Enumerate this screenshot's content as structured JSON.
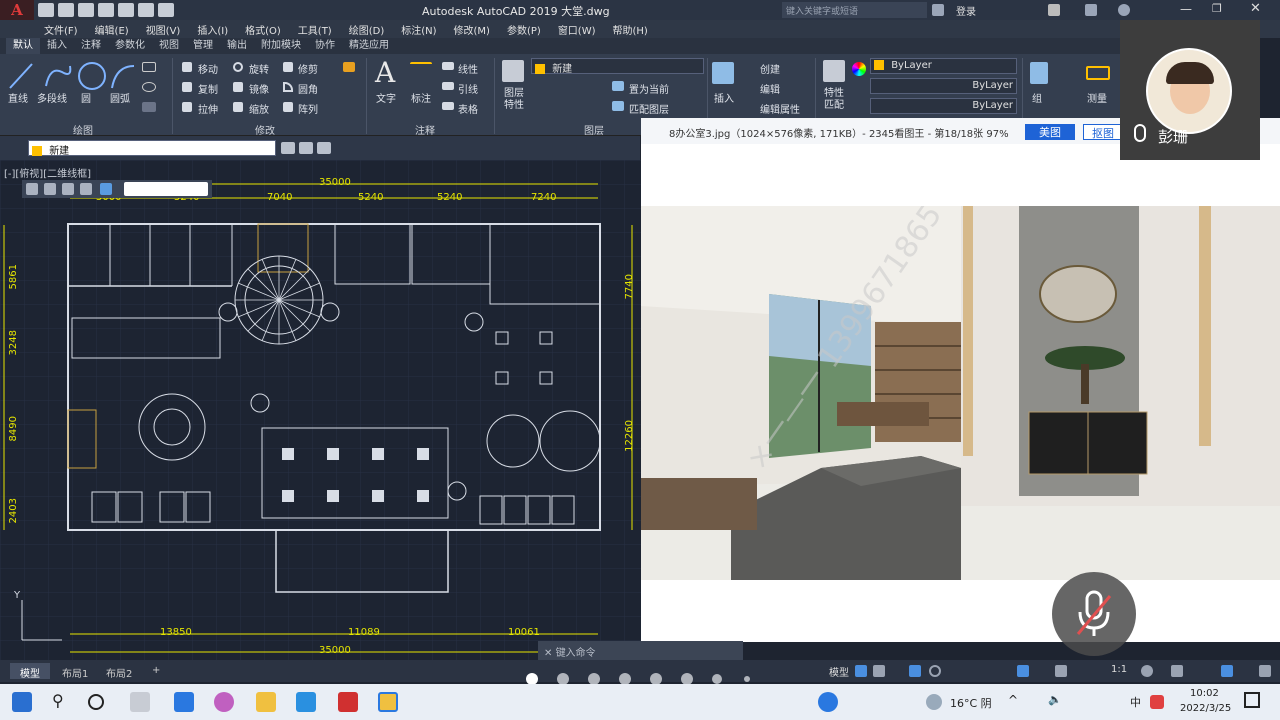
{
  "app": {
    "title": "Autodesk AutoCAD 2019    大堂.dwg",
    "search_placeholder": "键入关键字或短语",
    "login": "登录",
    "logo": "A"
  },
  "menu": [
    "文件(F)",
    "编辑(E)",
    "视图(V)",
    "插入(I)",
    "格式(O)",
    "工具(T)",
    "绘图(D)",
    "标注(N)",
    "修改(M)",
    "参数(P)",
    "窗口(W)",
    "帮助(H)"
  ],
  "ribbon_tabs": [
    "默认",
    "插入",
    "注释",
    "参数化",
    "视图",
    "管理",
    "输出",
    "附加模块",
    "协作",
    "精选应用"
  ],
  "ribbon": {
    "draw": {
      "line": "直线",
      "polyline": "多段线",
      "circle": "圆",
      "arc": "圆弧",
      "panel": "绘图"
    },
    "modify": {
      "move": "移动",
      "rotate": "旋转",
      "trim": "修剪",
      "copy": "复制",
      "mirror": "镜像",
      "fillet": "圆角",
      "stretch": "拉伸",
      "scale": "缩放",
      "array": "阵列",
      "panel": "修改"
    },
    "annotation": {
      "text": "文字",
      "dimension": "标注",
      "linear": "线性",
      "leader": "引线",
      "table": "表格",
      "panel": "注释"
    },
    "layers": {
      "props": "图层\n特性",
      "current": "新建",
      "set_current": "置为当前",
      "match": "匹配图层",
      "panel": "图层"
    },
    "block": {
      "insert": "插入",
      "create": "创建",
      "edit": "编辑",
      "edit_attr": "编辑属性"
    },
    "properties": {
      "match": "特性\n匹配",
      "bylayer1": "ByLayer",
      "bylayer2": "ByLayer",
      "bylayer3": "ByLayer"
    },
    "groups": {
      "group": "组"
    },
    "utilities": {
      "measure": "测量"
    }
  },
  "layer_strip": {
    "current_layer": "新建"
  },
  "viewport": {
    "label": "[-][俯视][二维线框]"
  },
  "dimensions": {
    "top_total": "35000",
    "top_segs": [
      "5000",
      "5240",
      "7040",
      "5240",
      "5240",
      "7240"
    ],
    "left_segs": [
      "5861",
      "3248",
      "8490",
      "2403"
    ],
    "right_segs": [
      "7740",
      "12260"
    ],
    "bottom_segs": [
      "13850",
      "11089",
      "10061"
    ],
    "bottom_total": "35000"
  },
  "viewer": {
    "title": "8办公室3.jpg（1024×576像素, 171KB）- 2345看图王 - 第18/18张 97%",
    "btn_beautify": "美图",
    "btn_cutout": "抠图",
    "watermark": "×一—一 1399671865 3"
  },
  "layout_tabs": [
    "模型",
    "布局1",
    "布局2",
    "+"
  ],
  "command": {
    "placeholder": "键入命令"
  },
  "status": {
    "model": "模型",
    "scale": "1:1"
  },
  "camera": {
    "name": "彭珊"
  },
  "taskbar": {
    "weather": "16°C 阴",
    "time": "10:02",
    "date": "2022/3/25",
    "ime": "中"
  },
  "colors": {
    "accent": "#1e63d6",
    "cad_bg": "#1d2432",
    "dim_yellow": "#e6e600",
    "logo_red": "#e03a3a",
    "layer_yellow": "#ffc000"
  }
}
